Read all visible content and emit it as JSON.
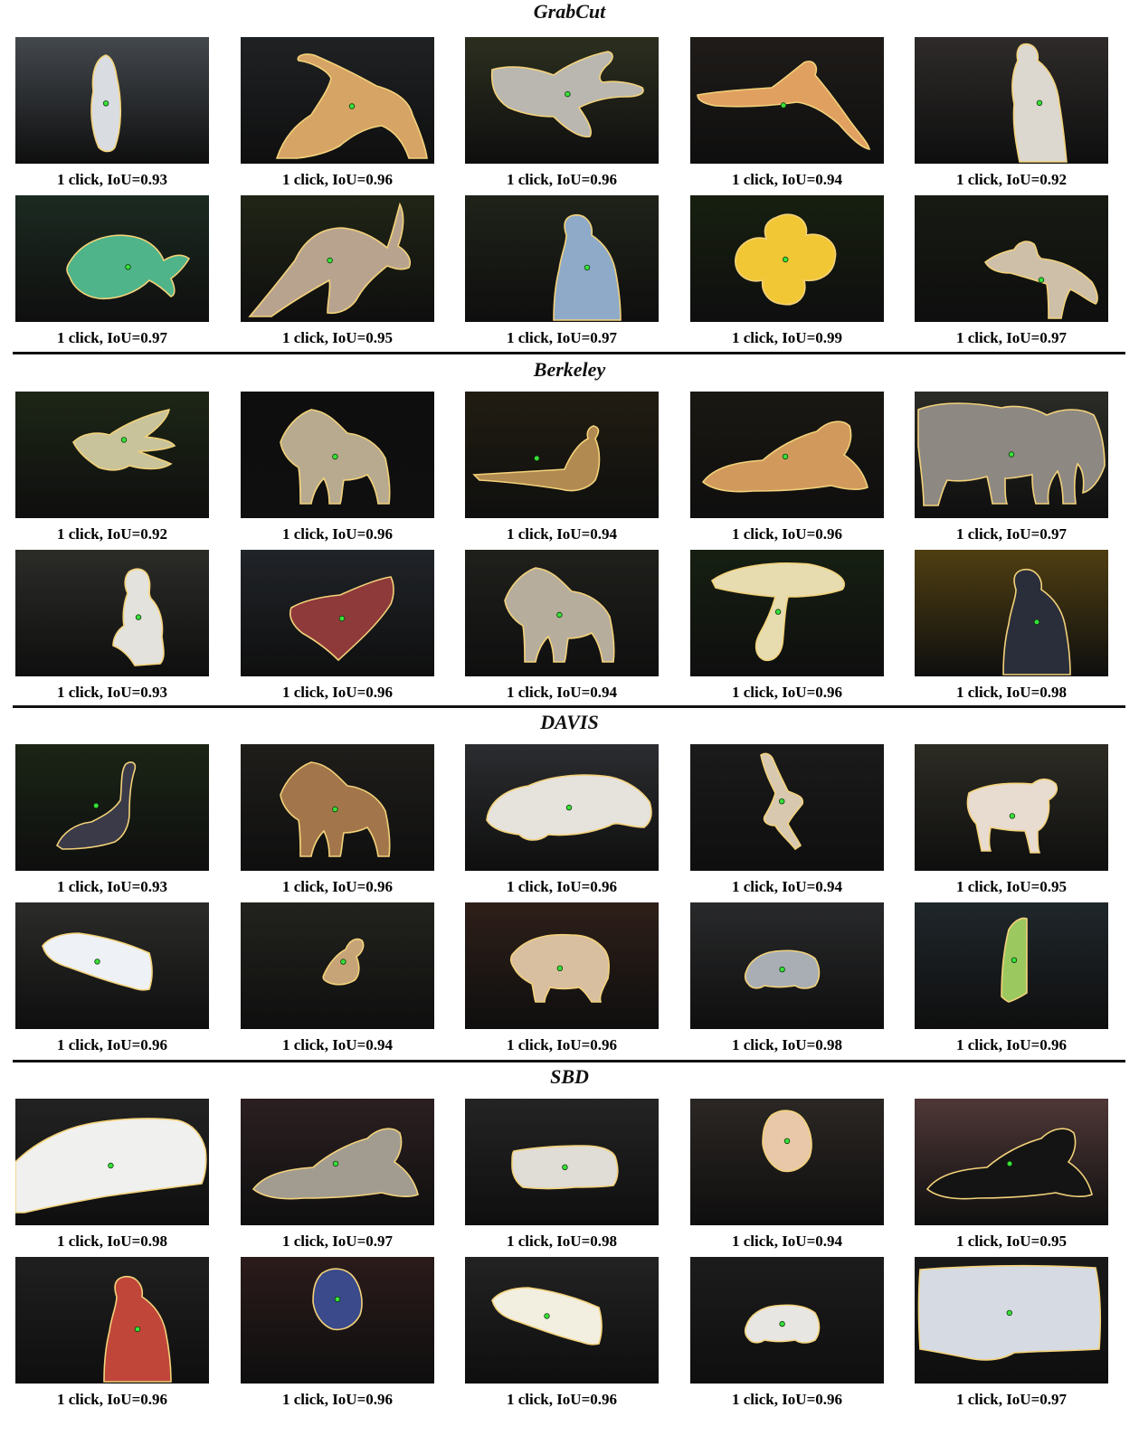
{
  "figure": {
    "sections": [
      {
        "title": "GrabCut",
        "items": [
          {
            "caption": "1 click, IoU=0.93",
            "subject": "penguin-icon",
            "bg": "#5a6168",
            "fg": "#d9dde2",
            "shape": "tall"
          },
          {
            "caption": "1 click, IoU=0.96",
            "subject": "swimmer-icon",
            "bg": "#2a2d30",
            "fg": "#d6a465",
            "shape": "crouch"
          },
          {
            "caption": "1 click, IoU=0.96",
            "subject": "jet-icon",
            "bg": "#3b3f2a",
            "fg": "#b9b7b0",
            "shape": "plane"
          },
          {
            "caption": "1 click, IoU=0.94",
            "subject": "diver-icon",
            "bg": "#2a2622",
            "fg": "#e0a060",
            "shape": "diver"
          },
          {
            "caption": "1 click, IoU=0.92",
            "subject": "statue-icon",
            "bg": "#3e3a38",
            "fg": "#dcd8d0",
            "shape": "statue"
          }
        ]
      },
      {
        "items": [
          {
            "caption": "1 click, IoU=0.97",
            "subject": "fish-icon",
            "bg": "#25392c",
            "fg": "#4fb489",
            "shape": "fish"
          },
          {
            "caption": "1 click, IoU=0.95",
            "subject": "kangaroo-icon",
            "bg": "#2c321e",
            "fg": "#b8a48e",
            "shape": "leap"
          },
          {
            "caption": "1 click, IoU=0.97",
            "subject": "person-icon",
            "bg": "#2a2f22",
            "fg": "#8eaac8",
            "shape": "person"
          },
          {
            "caption": "1 click, IoU=0.99",
            "subject": "flower-icon",
            "bg": "#1f2a16",
            "fg": "#f2c736",
            "shape": "flower"
          },
          {
            "caption": "1 click, IoU=0.97",
            "subject": "runner-icon",
            "bg": "#1f2419",
            "fg": "#cdbfa8",
            "shape": "runner"
          }
        ]
      },
      {
        "title": "Berkeley",
        "items": [
          {
            "caption": "1 click, IoU=0.92",
            "subject": "bird-icon",
            "bg": "#27331e",
            "fg": "#c8c39a",
            "shape": "bird"
          },
          {
            "caption": "1 click, IoU=0.96",
            "subject": "wolf-icon",
            "bg": "#131313",
            "fg": "#b7aa8e",
            "shape": "quad"
          },
          {
            "caption": "1 click, IoU=0.94",
            "subject": "pheasant-icon",
            "bg": "#2d2718",
            "fg": "#b08a50",
            "shape": "pheasant"
          },
          {
            "caption": "1 click, IoU=0.96",
            "subject": "tiger-icon",
            "bg": "#232019",
            "fg": "#d19a5c",
            "shape": "lying"
          },
          {
            "caption": "1 click, IoU=0.97",
            "subject": "elephant-icon",
            "bg": "#3a3a35",
            "fg": "#8d8882",
            "shape": "elephant"
          }
        ]
      },
      {
        "items": [
          {
            "caption": "1 click, IoU=0.93",
            "subject": "person-icon",
            "bg": "#3a3a36",
            "fg": "#e4e2dc",
            "shape": "squat"
          },
          {
            "caption": "1 click, IoU=0.96",
            "subject": "boat-icon",
            "bg": "#2c3036",
            "fg": "#8f3a3a",
            "shape": "boat"
          },
          {
            "caption": "1 click, IoU=0.94",
            "subject": "dog-icon",
            "bg": "#2a2a26",
            "fg": "#b6ad9c",
            "shape": "quad"
          },
          {
            "caption": "1 click, IoU=0.96",
            "subject": "mushroom-icon",
            "bg": "#1e2a18",
            "fg": "#e6dcb0",
            "shape": "mushroom"
          },
          {
            "caption": "1 click, IoU=0.98",
            "subject": "person-icon",
            "bg": "#6a5418",
            "fg": "#2a2e3a",
            "shape": "person"
          }
        ]
      },
      {
        "title": "DAVIS",
        "items": [
          {
            "caption": "1 click, IoU=0.93",
            "subject": "swan-icon",
            "bg": "#24311d",
            "fg": "#3b3a48",
            "shape": "swan"
          },
          {
            "caption": "1 click, IoU=0.96",
            "subject": "bear-icon",
            "bg": "#2a2824",
            "fg": "#a2764a",
            "shape": "quad"
          },
          {
            "caption": "1 click, IoU=0.96",
            "subject": "car-icon",
            "bg": "#3a3c40",
            "fg": "#e6e2dc",
            "shape": "car"
          },
          {
            "caption": "1 click, IoU=0.94",
            "subject": "dancer-icon",
            "bg": "#242424",
            "fg": "#d8c8b0",
            "shape": "dancer"
          },
          {
            "caption": "1 click, IoU=0.95",
            "subject": "cow-icon",
            "bg": "#3c3a30",
            "fg": "#e8dcd0",
            "shape": "cow"
          }
        ]
      },
      {
        "items": [
          {
            "caption": "1 click, IoU=0.96",
            "subject": "bus-icon",
            "bg": "#3a3a38",
            "fg": "#eef2f6",
            "shape": "bus"
          },
          {
            "caption": "1 click, IoU=0.94",
            "subject": "duck-icon",
            "bg": "#2e2e28",
            "fg": "#c6a478",
            "shape": "duck"
          },
          {
            "caption": "1 click, IoU=0.96",
            "subject": "rhino-icon",
            "bg": "#3e2a22",
            "fg": "#d8bfa0",
            "shape": "rhino"
          },
          {
            "caption": "1 click, IoU=0.98",
            "subject": "car-icon",
            "bg": "#37383a",
            "fg": "#a8aeb4",
            "shape": "smallcar"
          },
          {
            "caption": "1 click, IoU=0.96",
            "subject": "windsurfer-icon",
            "bg": "#2a343a",
            "fg": "#9cc860",
            "shape": "sail"
          }
        ]
      },
      {
        "title": "SBD",
        "items": [
          {
            "caption": "1 click, IoU=0.98",
            "subject": "limousine-icon",
            "bg": "#2e2e2e",
            "fg": "#f0f0ee",
            "shape": "limo"
          },
          {
            "caption": "1 click, IoU=0.97",
            "subject": "cat-icon",
            "bg": "#3a2a2c",
            "fg": "#a29c90",
            "shape": "lying"
          },
          {
            "caption": "1 click, IoU=0.98",
            "subject": "sofa-icon",
            "bg": "#303030",
            "fg": "#e0dcd6",
            "shape": "sofa"
          },
          {
            "caption": "1 click, IoU=0.94",
            "subject": "face-icon",
            "bg": "#3a3430",
            "fg": "#e8c8a8",
            "shape": "face"
          },
          {
            "caption": "1 click, IoU=0.95",
            "subject": "dog-icon",
            "bg": "#6a4a4a",
            "fg": "#141414",
            "shape": "lying"
          }
        ]
      },
      {
        "items": [
          {
            "caption": "1 click, IoU=0.96",
            "subject": "person-icon",
            "bg": "#2a2a2a",
            "fg": "#c0463a",
            "shape": "person"
          },
          {
            "caption": "1 click, IoU=0.96",
            "subject": "person-icon",
            "bg": "#3a2424",
            "fg": "#3a4a8a",
            "shape": "face"
          },
          {
            "caption": "1 click, IoU=0.96",
            "subject": "bus-icon",
            "bg": "#2e2e2e",
            "fg": "#f2eee0",
            "shape": "bus"
          },
          {
            "caption": "1 click, IoU=0.96",
            "subject": "jeep-icon",
            "bg": "#262626",
            "fg": "#e8e6e2",
            "shape": "smallcar"
          },
          {
            "caption": "1 click, IoU=0.97",
            "subject": "monitor-icon",
            "bg": "#222222",
            "fg": "#d6dae2",
            "shape": "monitor"
          }
        ]
      }
    ]
  }
}
